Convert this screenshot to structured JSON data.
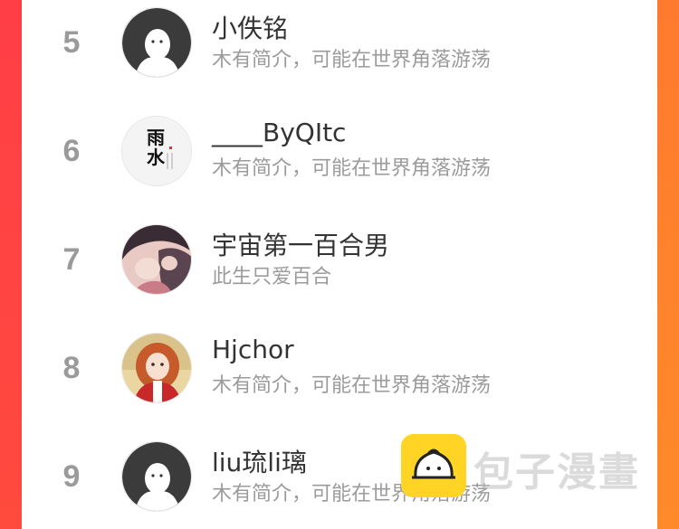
{
  "rows": [
    {
      "rank": "5",
      "name": "小佚铭",
      "bio": "木有简介，可能在世界角落游荡",
      "avatar": "default-avatar"
    },
    {
      "rank": "6",
      "name": "____ByQItc",
      "bio": "木有简介，可能在世界角落游荡",
      "avatar": "calligraphy-avatar"
    },
    {
      "rank": "7",
      "name": "宇宙第一百合男",
      "bio": "此生只爱百合",
      "avatar": "anime-couple-avatar"
    },
    {
      "rank": "8",
      "name": "Hjchor",
      "bio": "木有简介，可能在世界角落游荡",
      "avatar": "anime-girl-avatar"
    },
    {
      "rank": "9",
      "name": "liu琉li璃",
      "bio": "木有简介，可能在世界角落游荡",
      "avatar": "default-avatar"
    }
  ],
  "watermark": {
    "text": "包子漫畫",
    "icon": "baozi-logo-icon"
  },
  "colors": {
    "left_border": "#ff3e46",
    "right_border": "#ff7a2e",
    "rank": "#9a9a9a",
    "name": "#333333",
    "bio": "#9b9b9b",
    "logo": "#ffd424"
  }
}
